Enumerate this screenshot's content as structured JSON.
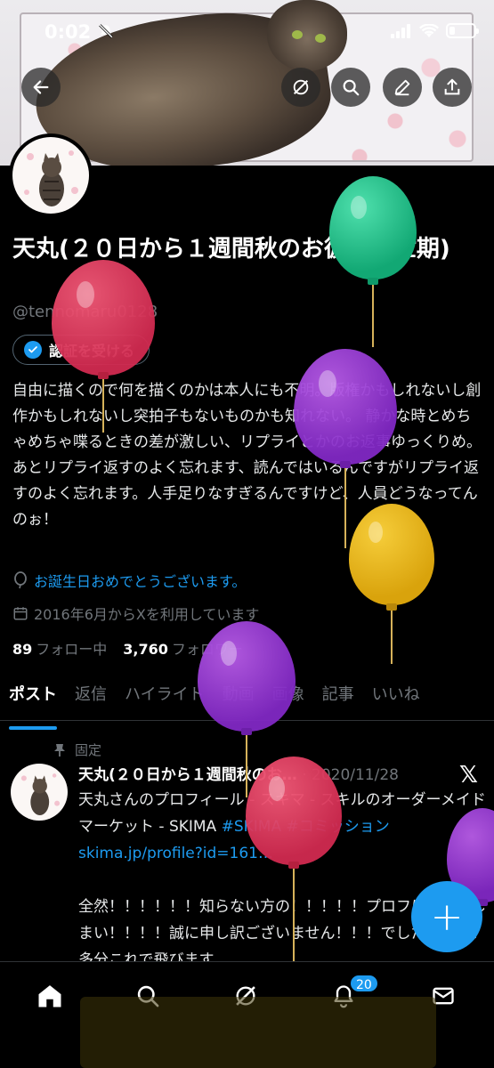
{
  "status_bar": {
    "time": "0:02"
  },
  "header": {
    "back_icon": "arrow-left-icon",
    "actions": [
      "grok-icon",
      "search-icon",
      "edit-icon",
      "share-icon"
    ]
  },
  "profile": {
    "name": "天丸(２０日から１週間秋のお彼岸繁忙期)",
    "handle": "@tennomaru0128",
    "verify_label": "認証を受ける",
    "bio": "自由に描くので何を描くのかは本人にも不明。版権かもしれないし創作かもしれないし突拍子もないものかも知れない。 静かな時とめちゃめちゃ喋るときの差が激しい、リプライとかのお返事ゆっくりめ。 あとリプライ返すのよく忘れます、読んではいるんですがリプライ返すのよく忘れます。人手足りなすぎるんですけど、人員どうなってんのぉ！",
    "birthday_text": "お誕生日おめでとうございます。",
    "joined_text": "2016年6月からXを利用しています",
    "following_count": "89",
    "following_label": "フォロー中",
    "followers_count": "3,760",
    "followers_label": "フォロワー"
  },
  "tabs": [
    "ポスト",
    "返信",
    "ハイライト",
    "動画",
    "画像",
    "記事",
    "いいね"
  ],
  "pinned_post": {
    "pinned_label": "固定",
    "author": "天丸(２０日から１週間秋のお…",
    "date": "2020/11/28",
    "line1": "天丸さんのプロフィール - スキマ - スキルのオーダーメイドマーケット - SKIMA ",
    "hashtag1": "#SKIMA",
    "hashtag2": "#コミッション",
    "link": "skima.jp/profile?id=161…",
    "line2": "全然！！！！！！知らない方の！！！！！プロフに飛んでしまい！！！！誠に申し訳ございません！！！でした！！！！多分これで飛びます"
  },
  "bottom_nav": {
    "items": [
      "home-icon",
      "search-icon",
      "grok-icon",
      "bell-icon",
      "mail-icon"
    ],
    "notification_count": "20"
  },
  "fab_label": "+",
  "colors": {
    "accent": "#1d9bf0",
    "background": "#000000",
    "text": "#e7e9ea",
    "muted": "#71767b"
  }
}
